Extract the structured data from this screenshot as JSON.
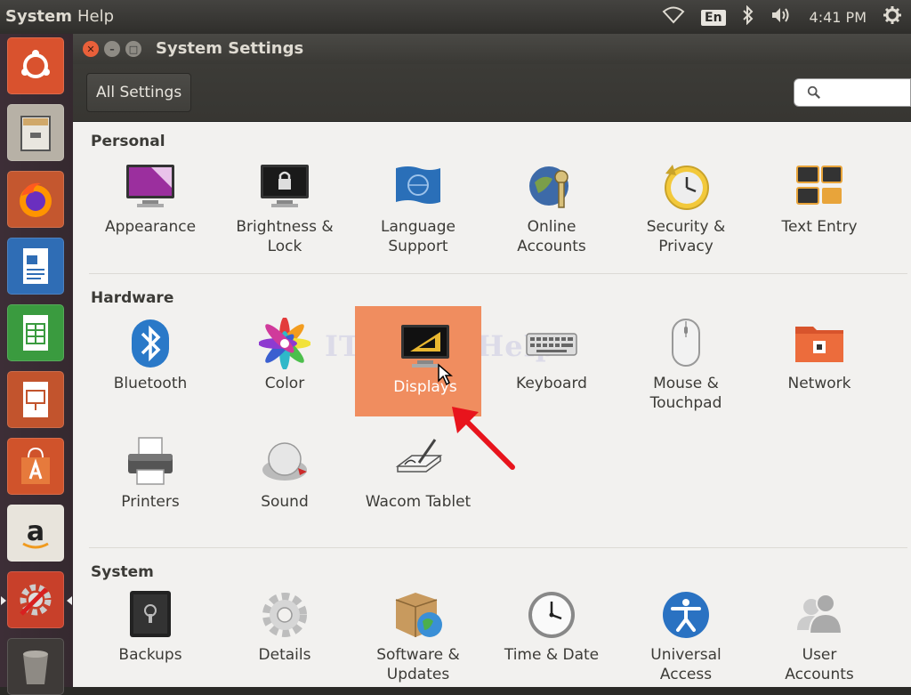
{
  "top_panel": {
    "menu": [
      "System",
      "Help"
    ],
    "lang": "En",
    "clock": "4:41 PM",
    "icons": [
      "wifi-icon",
      "bluetooth-icon",
      "volume-icon",
      "gear-icon"
    ]
  },
  "launcher": {
    "items": [
      "ubuntu-dash",
      "files",
      "firefox",
      "libreoffice-writer",
      "libreoffice-calc",
      "libreoffice-impress",
      "software-center",
      "amazon",
      "system-settings",
      "trash"
    ]
  },
  "window": {
    "title": "System Settings",
    "all_settings": "All Settings",
    "search_placeholder": ""
  },
  "sections": [
    {
      "title": "Personal",
      "items": [
        {
          "label": "Appearance",
          "icon": "appearance-icon"
        },
        {
          "label": "Brightness &\nLock",
          "icon": "lock-icon"
        },
        {
          "label": "Language\nSupport",
          "icon": "language-flag-icon"
        },
        {
          "label": "Online\nAccounts",
          "icon": "online-accounts-icon"
        },
        {
          "label": "Security &\nPrivacy",
          "icon": "security-icon"
        },
        {
          "label": "Text Entry",
          "icon": "keyboard-keys-icon"
        }
      ]
    },
    {
      "title": "Hardware",
      "items": [
        {
          "label": "Bluetooth",
          "icon": "bluetooth-icon"
        },
        {
          "label": "Color",
          "icon": "color-icon"
        },
        {
          "label": "Displays",
          "icon": "display-icon",
          "selected": true
        },
        {
          "label": "Keyboard",
          "icon": "keyboard-icon"
        },
        {
          "label": "Mouse &\nTouchpad",
          "icon": "mouse-icon"
        },
        {
          "label": "Network",
          "icon": "network-icon"
        },
        {
          "label": "Printers",
          "icon": "printer-icon"
        },
        {
          "label": "Sound",
          "icon": "sound-icon"
        },
        {
          "label": "Wacom Tablet",
          "icon": "tablet-icon"
        }
      ]
    },
    {
      "title": "System",
      "items": [
        {
          "label": "Backups",
          "icon": "safe-icon"
        },
        {
          "label": "Details",
          "icon": "gear-icon"
        },
        {
          "label": "Software &\nUpdates",
          "icon": "package-icon"
        },
        {
          "label": "Time & Date",
          "icon": "clock-icon"
        },
        {
          "label": "Universal\nAccess",
          "icon": "accessibility-icon"
        },
        {
          "label": "User\nAccounts",
          "icon": "users-icon"
        }
      ]
    }
  ],
  "colors": {
    "selection": "#f08d5f",
    "annotation_arrow": "#e8141c"
  }
}
